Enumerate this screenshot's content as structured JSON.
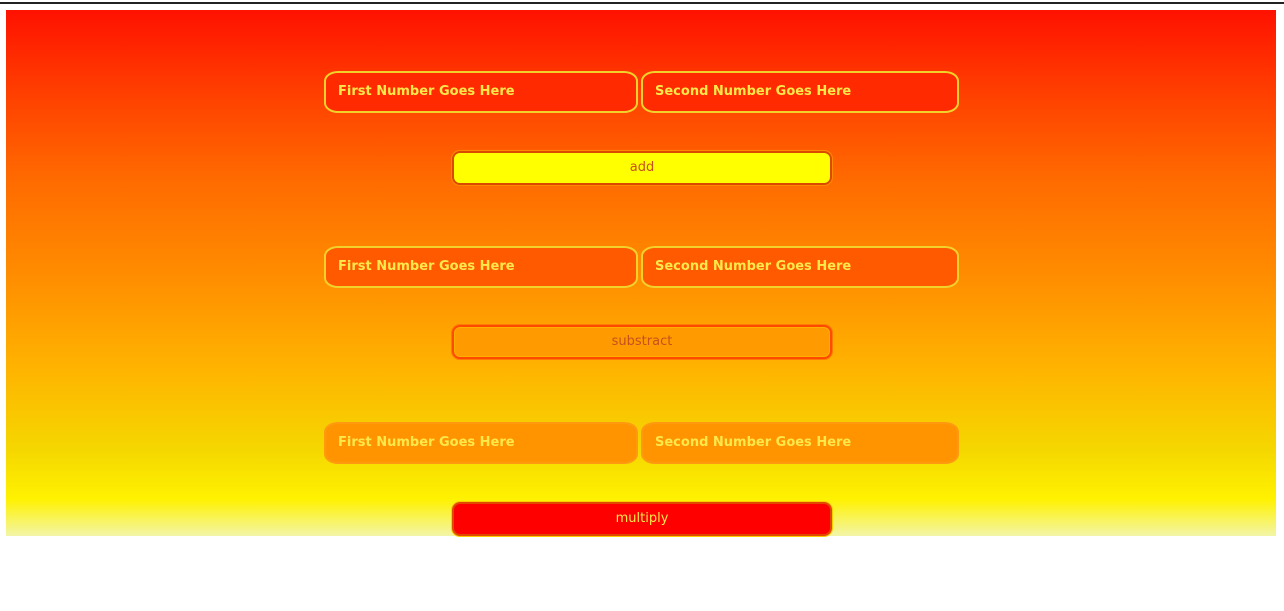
{
  "calculator": {
    "add_section": {
      "first_placeholder": "First Number Goes Here",
      "second_placeholder": "Second Number Goes Here",
      "button_label": "add"
    },
    "subtract_section": {
      "first_placeholder": "First Number Goes Here",
      "second_placeholder": "Second Number Goes Here",
      "button_label": "substract"
    },
    "multiply_section": {
      "first_placeholder": "First Number Goes Here",
      "second_placeholder": "Second Number Goes Here",
      "button_label": "multiply"
    }
  },
  "colors": {
    "gradient_top": "#ff1100",
    "gradient_middle": "#ff8c00",
    "gradient_bottom": "#fff200",
    "field_text": "#ffe84a",
    "add_button_bg": "#ffff00",
    "subtract_button_bg": "#ff9a00",
    "multiply_button_bg": "#ff0000"
  }
}
